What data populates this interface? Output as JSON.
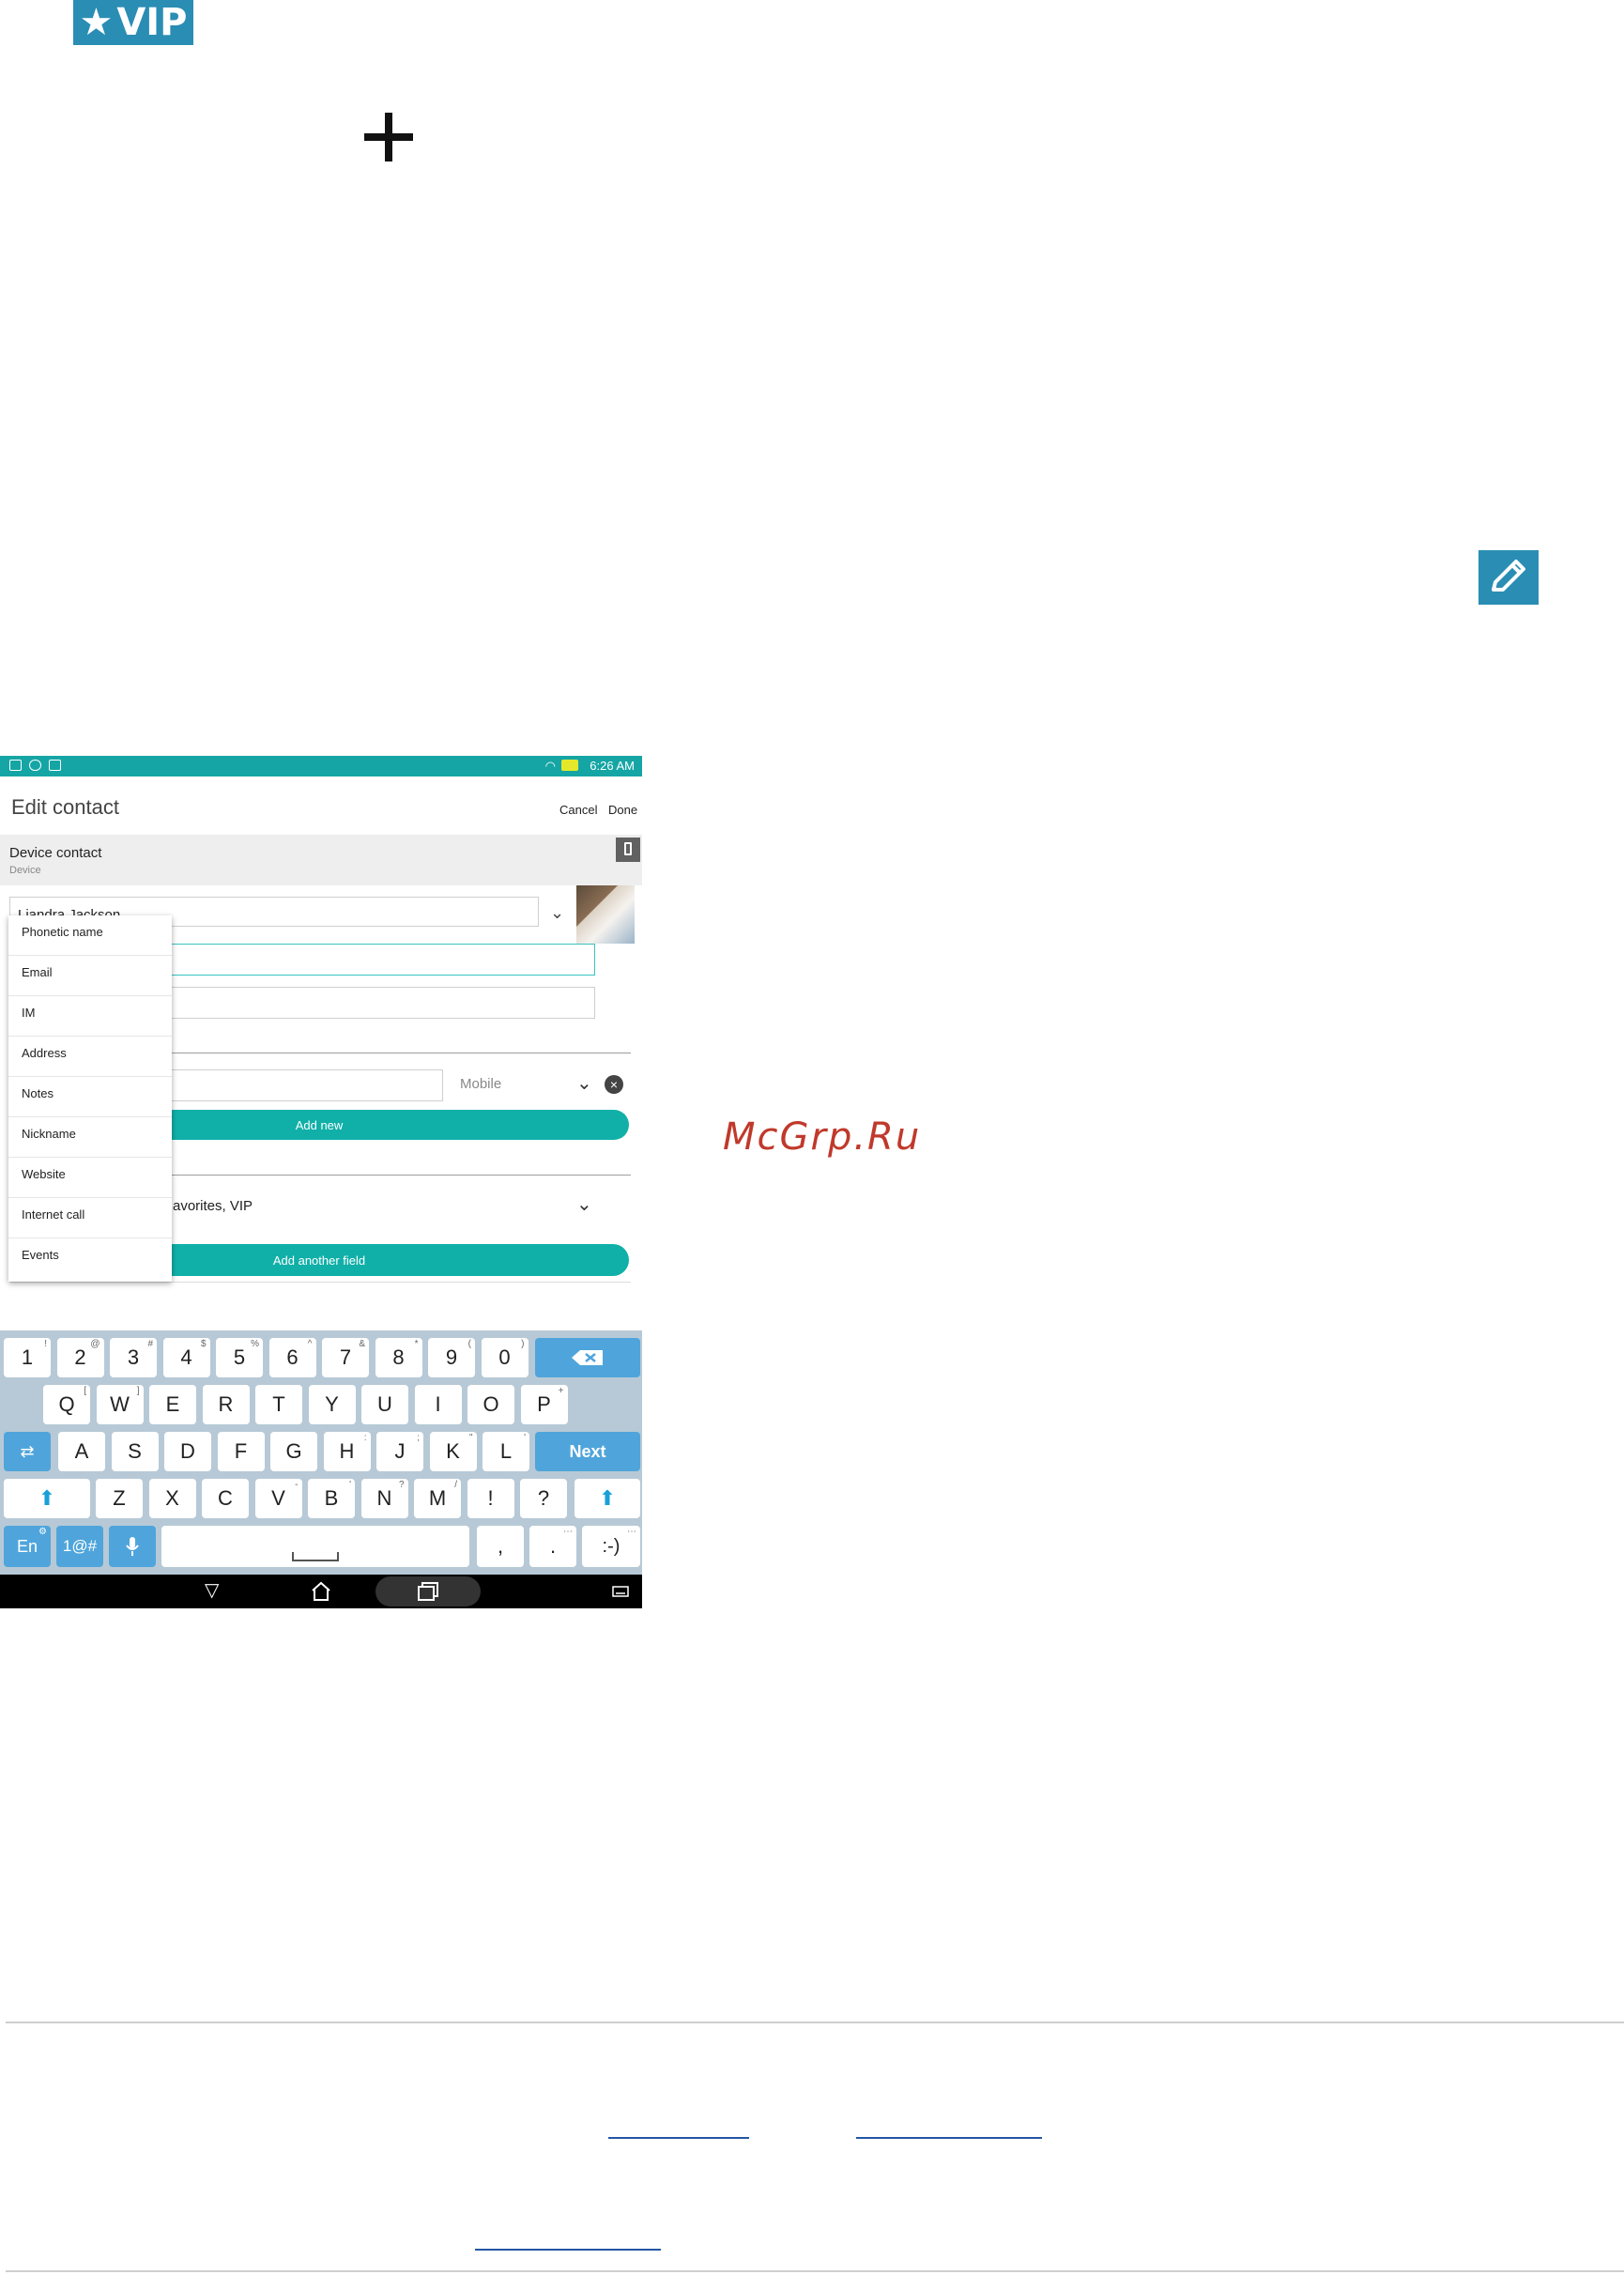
{
  "document": {
    "vip_badge": "VIP",
    "watermark": "McGrp.Ru"
  },
  "screenshot": {
    "status_time": "6:26 AM",
    "app_title": "Edit contact",
    "cancel_label": "Cancel",
    "done_label": "Done",
    "account_name": "Device contact",
    "account_type": "Device",
    "contact_name": "Liandra Jackson",
    "phone_type": "Mobile",
    "add_new_label": "Add new",
    "groups_value": "avorites, VIP",
    "add_field_label": "Add another field",
    "menu_items": [
      "Phonetic name",
      "Email",
      "IM",
      "Address",
      "Notes",
      "Nickname",
      "Website",
      "Internet call",
      "Events"
    ],
    "keyboard": {
      "row1": [
        {
          "k": "1",
          "s": "!"
        },
        {
          "k": "2",
          "s": "@"
        },
        {
          "k": "3",
          "s": "#"
        },
        {
          "k": "4",
          "s": "$"
        },
        {
          "k": "5",
          "s": "%"
        },
        {
          "k": "6",
          "s": "^"
        },
        {
          "k": "7",
          "s": "&"
        },
        {
          "k": "8",
          "s": "*"
        },
        {
          "k": "9",
          "s": "("
        },
        {
          "k": "0",
          "s": ")"
        }
      ],
      "row2": [
        {
          "k": "Q",
          "s": "["
        },
        {
          "k": "W",
          "s": "]"
        },
        {
          "k": "E",
          "s": ""
        },
        {
          "k": "R",
          "s": ""
        },
        {
          "k": "T",
          "s": ""
        },
        {
          "k": "Y",
          "s": ""
        },
        {
          "k": "U",
          "s": ""
        },
        {
          "k": "I",
          "s": ""
        },
        {
          "k": "O",
          "s": ""
        },
        {
          "k": "P",
          "s": "+"
        }
      ],
      "row3": [
        {
          "k": "A",
          "s": ""
        },
        {
          "k": "S",
          "s": ""
        },
        {
          "k": "D",
          "s": ""
        },
        {
          "k": "F",
          "s": ""
        },
        {
          "k": "G",
          "s": ""
        },
        {
          "k": "H",
          "s": ":"
        },
        {
          "k": "J",
          "s": ";"
        },
        {
          "k": "K",
          "s": "\""
        },
        {
          "k": "L",
          "s": "'"
        }
      ],
      "row4": [
        {
          "k": "Z",
          "s": ""
        },
        {
          "k": "X",
          "s": ""
        },
        {
          "k": "C",
          "s": ""
        },
        {
          "k": "V",
          "s": "-"
        },
        {
          "k": "B",
          "s": "'"
        },
        {
          "k": "N",
          "s": "?"
        },
        {
          "k": "M",
          "s": "/"
        },
        {
          "k": "!",
          "s": ""
        },
        {
          "k": "?",
          "s": ""
        }
      ],
      "next_label": "Next",
      "lang_label": "En",
      "symbols_label": "1@#",
      "comma_label": ",",
      "period_label": ".",
      "emoji_label": ":-)"
    }
  }
}
